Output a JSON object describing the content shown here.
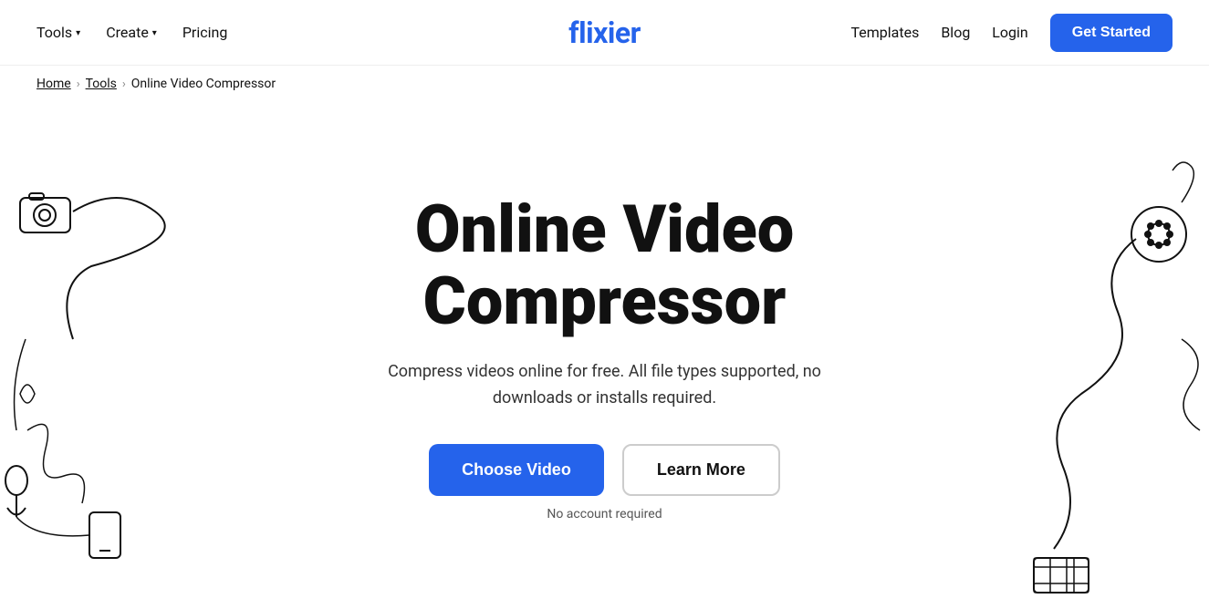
{
  "nav": {
    "logo": "flixier",
    "left": [
      {
        "label": "Tools",
        "hasDropdown": true
      },
      {
        "label": "Create",
        "hasDropdown": true
      },
      {
        "label": "Pricing",
        "hasDropdown": false
      }
    ],
    "right": [
      {
        "label": "Templates"
      },
      {
        "label": "Blog"
      },
      {
        "label": "Login"
      }
    ],
    "cta": "Get Started"
  },
  "breadcrumb": {
    "home": "Home",
    "tools": "Tools",
    "current": "Online Video Compressor"
  },
  "hero": {
    "title": "Online Video Compressor",
    "subtitle": "Compress videos online for free. All file types supported, no downloads or installs required.",
    "choose_video": "Choose Video",
    "learn_more": "Learn More",
    "no_account": "No account required"
  }
}
